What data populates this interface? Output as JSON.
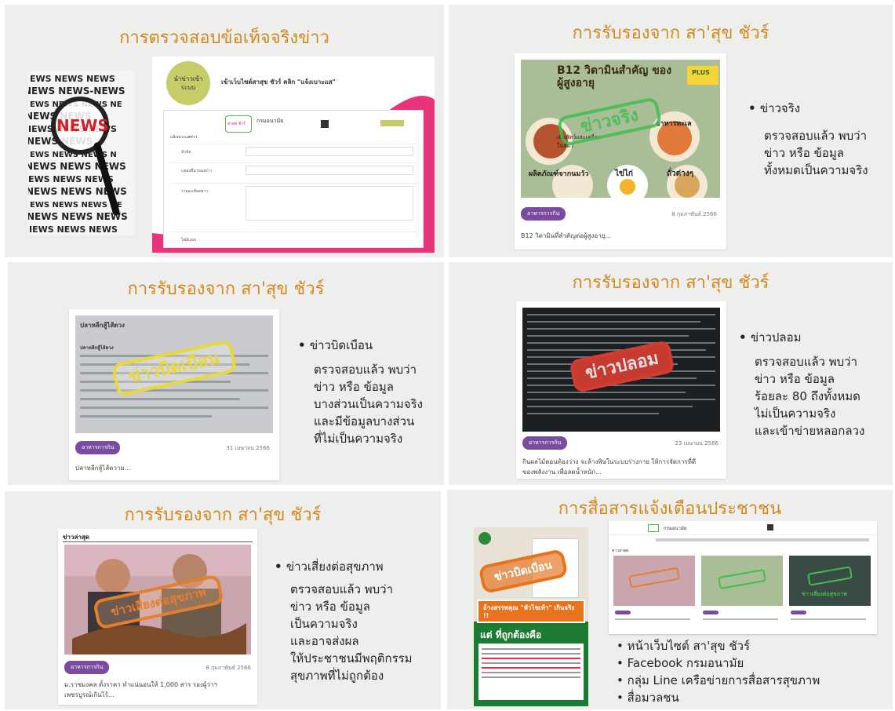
{
  "colors": {
    "title": "#d4891f",
    "panel_bg": "#eeeeed",
    "badge": "#7a4ca0",
    "stamp_green": "#3fbf4f",
    "stamp_yellow": "#e8d93a",
    "stamp_red": "#d63b2f",
    "stamp_orange": "#e57f2e",
    "pink": "#e8347a"
  },
  "p1": {
    "title": "การตรวจสอบข้อเท็จจริงข่าว",
    "news_word": "NEWS",
    "circle_label": "นำข่าวเข้าระบบ",
    "header_text": "เข้าเว็บไซต์สาสุข ชัวร์ คลิก \"แจ้งเบาะแส\"",
    "site_name": "กรมอนามัย",
    "logo_text": "สาสุข ชัวร์",
    "form_section": "แจ้งเบาะแสข่าว",
    "field1": "หัวข้อ",
    "field2": "แหล่งที่มาของข่าว",
    "field3": "รายละเอียดข่าว",
    "field4": "ไฟล์แนบ"
  },
  "p2": {
    "title": "การรับรองจาก สา'สุข ชัวร์",
    "img_title": "B12 วิตามินสำคัญ ของผู้สูงอายุ",
    "img_plus": "PLUS",
    "food1": "เนื้อสัตว์และเครื่องในสัตว์",
    "food2": "อาหารทะเล",
    "food3": "ผลิตภัณฑ์จากนมวัว",
    "food4": "ไข่ไก่",
    "food5": "ถั่วต่างๆ",
    "stamp": "ข่าวจริง",
    "badge": "อาหารการกิน",
    "date": "8 กุมภาพันธ์ 2566",
    "caption": "B12 วิตามินที่สำคัญต่อผู้สูงอายุ...",
    "bullet": "ข่าวจริง",
    "lines": [
      "ตรวจสอบแล้ว พบว่า",
      "ข่าว หรือ ข้อมูล",
      "ทั้งหมดเป็นความจริง"
    ]
  },
  "p3": {
    "title": "การรับรองจาก สา'สุข ชัวร์",
    "img_heading": "ปลาหลีกสู้ไส้ตวง",
    "img_sub": "ปลาหลีกสู้ไส้ตวง",
    "stamp": "ข่าวบิดเบือน",
    "badge": "อาหารการกิน",
    "date": "31 เมษายน 2566",
    "caption": "ปลาหลีกสู้ไส้ตวาม...",
    "bullet": "ข่าวบิดเบือน",
    "lines": [
      "ตรวจสอบแล้ว พบว่า",
      "ข่าว หรือ ข้อมูล",
      "บางส่วนเป็นความจริง",
      "และมีข้อมูลบางส่วน",
      "ที่ไม่เป็นความจริง"
    ]
  },
  "p4": {
    "title": "การรับรองจาก สา'สุข ชัวร์",
    "stamp": "ข่าวปลอม",
    "badge": "อาหารการกิน",
    "date": "23 เมษายน 2566",
    "caption": "กินผลไม้ตอนท้องว่าง จะล้างพิษในระบบร่างกาย ให้การจัดการที่ดี",
    "caption2": "ของพลังงาน เพื่อลดน้ำหนัก...",
    "bullet": "ข่าวปลอม",
    "lines": [
      "ตรวจสอบแล้ว พบว่า",
      "ข่าว หรือ ข้อมูล",
      "ร้อยละ 80 ถึงทั้งหมด",
      "ไม่เป็นความจริง",
      "และเข้าข่ายหลอกลวง"
    ]
  },
  "p5": {
    "title": "การรับรองจาก สา'สุข ชัวร์",
    "section": "ข่าวล่าสุด",
    "stamp": "ข่าวเสี่ยงต่อสุขภาพ",
    "badge": "อาหารการกิน",
    "date": "8 กุมภาพันธ์ 2566",
    "caption": "ม.ราชมงคล ตั้งราคา ทำแน่นอนให้ 1,000 สาร รองผู้ว่าฯ",
    "caption2": "เพชรบูรณ์เกินไร้...",
    "bullet": "ข่าวเสี่ยงต่อสุขภาพ",
    "lines": [
      "ตรวจสอบแล้ว พบว่า",
      "ข่าว หรือ ข้อมูล",
      "เป็นความจริง",
      "และอาจส่งผล",
      "ให้ประชาชนมีพฤติกรรม",
      "สุขภาพที่ไม่ถูกต้อง"
    ]
  },
  "p6": {
    "title": "การสื่อสารแจ้งเตือนประชาชน",
    "poster_stamp": "ข่าวบิดเบือน",
    "poster_claim": "อ้างสรรพคุณ \"หัวไชเท้า\" เกินจริง !!",
    "poster_correct": "แต่ ที่ถูกต้องคือ",
    "site_name": "กรมอนามัย",
    "news_label": "ข่าวล่าสุด",
    "mini_stamp": "ข่าวเสี่ยงต่อสุขภาพ",
    "bullets": [
      "หน้าเว็บไซต์ สา'สุข ชัวร์",
      "Facebook กรมอนามัย",
      "กลุ่ม Line เครือข่ายการสื่อสารสุขภาพ",
      "สื่อมวลชน"
    ]
  }
}
